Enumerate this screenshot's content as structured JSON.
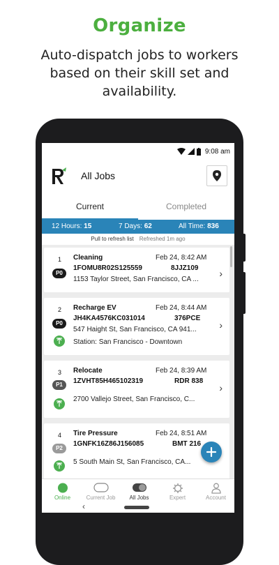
{
  "promo": {
    "headline": "Organize",
    "subline": "Auto-dispatch jobs to workers based on their skill set and availability."
  },
  "status_bar": {
    "time": "9:08 am"
  },
  "app_bar": {
    "title": "All Jobs",
    "logo_letter": "R"
  },
  "tabs": [
    {
      "label": "Current",
      "active": true
    },
    {
      "label": "Completed",
      "active": false
    }
  ],
  "stats": {
    "hours_label": "12 Hours:",
    "hours_value": "15",
    "days_label": "7 Days:",
    "days_value": "62",
    "all_label": "All Time:",
    "all_value": "836"
  },
  "refresh": {
    "pull_text": "Pull to refresh list",
    "refreshed_text": "Refreshed 1m ago"
  },
  "jobs": [
    {
      "num": "1",
      "priority": "P0",
      "title": "Cleaning",
      "date": "Feb 24, 8:42 AM",
      "vin": "1FOMU8R02S125559",
      "plate": "8JJZ109",
      "address": "1153 Taylor Street, San Francisco, CA ...",
      "station": ""
    },
    {
      "num": "2",
      "priority": "P0",
      "title": "Recharge EV",
      "date": "Feb 24, 8:44 AM",
      "vin": "JH4KA4576KC031014",
      "plate": "376PCE",
      "address": "547 Haight St, San Francisco, CA 941...",
      "station": "Station: San Francisco - Downtown"
    },
    {
      "num": "3",
      "priority": "P1",
      "title": "Relocate",
      "date": "Feb 24, 8:39 AM",
      "vin": "1ZVHT85H465102319",
      "plate": "RDR 838",
      "address": "2700 Vallejo Street, San Francisco, C...",
      "station": ""
    },
    {
      "num": "4",
      "priority": "P2",
      "title": "Tire Pressure",
      "date": "Feb 24, 8:51 AM",
      "vin": "1GNFK16Z86J156085",
      "plate": "BMT 216",
      "address": "5 South Main St, San Francisco, CA...",
      "station": ""
    }
  ],
  "colors": {
    "accent": "#2a84b8",
    "green": "#4caf50",
    "p0": "#1a1a1a",
    "p1": "#555555",
    "p2": "#9a9a9a"
  },
  "bottom_nav": [
    {
      "label": "Online",
      "icon": "online-dot-icon",
      "state": "active"
    },
    {
      "label": "Current Job",
      "icon": "current-job-icon",
      "state": "inactive"
    },
    {
      "label": "All Jobs",
      "icon": "all-jobs-toggle-icon",
      "state": "selected"
    },
    {
      "label": "Expert",
      "icon": "gear-icon",
      "state": "inactive"
    },
    {
      "label": "Account",
      "icon": "person-icon",
      "state": "inactive"
    }
  ]
}
